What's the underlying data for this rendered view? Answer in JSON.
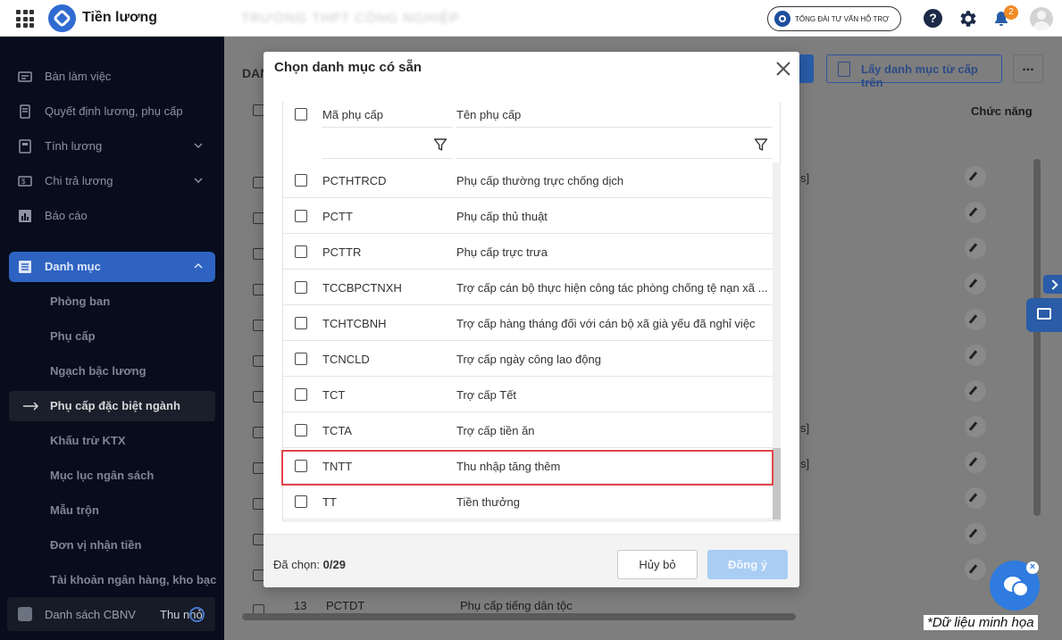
{
  "topbar": {
    "app_name": "Tiền lương",
    "school_name": "TRƯỜNG THPT CÔNG NGHIỆP",
    "support_label": "TỔNG ĐÀI TƯ VẤN HỖ TRỢ",
    "help_label": "?",
    "notification_count": "2"
  },
  "sidebar": {
    "items": [
      {
        "label": "Bàn làm việc"
      },
      {
        "label": "Quyết định lương, phụ cấp"
      },
      {
        "label": "Tính lương"
      },
      {
        "label": "Chi trả lương"
      },
      {
        "label": "Báo cáo"
      }
    ],
    "section_label": "Danh mục",
    "sub_items": [
      {
        "label": "Phòng ban"
      },
      {
        "label": "Phụ cấp"
      },
      {
        "label": "Ngạch bậc lương"
      },
      {
        "label": "Phụ cấp đặc biệt ngành"
      },
      {
        "label": "Khấu trừ KTX"
      },
      {
        "label": "Mục lục ngân sách"
      },
      {
        "label": "Mẫu trộn"
      },
      {
        "label": "Đơn vị nhận tiền"
      },
      {
        "label": "Tài khoản ngân hàng, kho bạc"
      }
    ],
    "bottom_label": "Danh sách CBNV",
    "collapse_label": "Thu nhỏ"
  },
  "main": {
    "title": "DAN",
    "fetch_button": "Lấy danh mục từ cấp trên",
    "more_label": "...",
    "col_function": "Chức năng",
    "bracket": "s]",
    "last_row": {
      "no": "13",
      "code": "PCTDT",
      "name": "Phụ cấp tiếng dân tộc"
    }
  },
  "modal": {
    "title": "Chọn danh mục có sẵn",
    "col_code": "Mã phụ cấp",
    "col_name": "Tên phụ cấp",
    "rows": [
      {
        "code": "PCTHTRCD",
        "name": "Phụ cấp thường trực chống dịch"
      },
      {
        "code": "PCTT",
        "name": "Phụ cấp thủ thuật"
      },
      {
        "code": "PCTTR",
        "name": "Phụ cấp trực trưa"
      },
      {
        "code": "TCCBPCTNXH",
        "name": "Trợ cấp cán bộ thực hiện công tác phòng chống tệ nạn xã ..."
      },
      {
        "code": "TCHTCBNH",
        "name": "Trợ cấp hàng tháng đối với cán bộ xã già yếu đã nghỉ việc"
      },
      {
        "code": "TCNCLD",
        "name": "Trợ cấp ngày công lao động"
      },
      {
        "code": "TCT",
        "name": "Trợ cấp Tết"
      },
      {
        "code": "TCTA",
        "name": "Trợ cấp tiền ăn"
      },
      {
        "code": "TNTT",
        "name": "Thu nhập tăng thêm"
      },
      {
        "code": "TT",
        "name": "Tiền thưởng"
      }
    ],
    "selected_label": "Đã chọn: ",
    "selected_count": "0/29",
    "cancel_label": "Hủy bỏ",
    "ok_label": "Đồng ý"
  },
  "watermark": "*Dữ liệu minh họa",
  "colors": {
    "accent": "#2e63c2",
    "highlight": "#e2454a",
    "ok_disabled": "#a9cdf3"
  }
}
